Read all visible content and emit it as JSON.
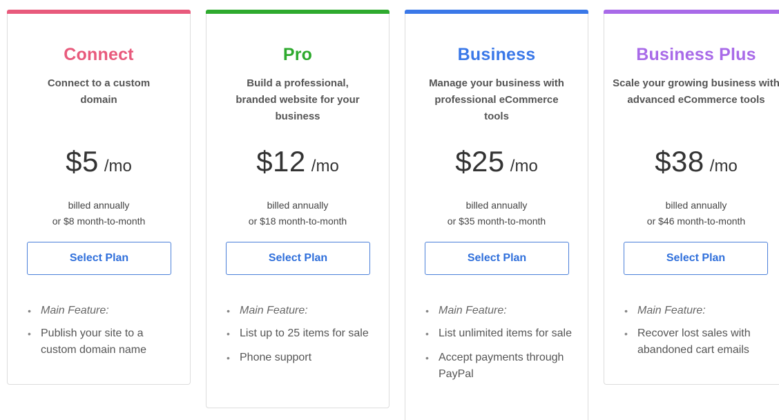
{
  "common": {
    "bullet_glyph": "•"
  },
  "plans": [
    {
      "name": "Connect",
      "color": "#e85a7c",
      "description": "Connect to a custom domain",
      "price": "$5",
      "unit": "/mo",
      "billing_line1": "billed annually",
      "billing_line2": "or $8 month-to-month",
      "button_label": "Select Plan",
      "main_feature_label": "Main Feature:",
      "features": [
        "Publish your site to a custom domain name"
      ]
    },
    {
      "name": "Pro",
      "color": "#2eaa2e",
      "description": "Build a professional, branded website for your business",
      "price": "$12",
      "unit": "/mo",
      "billing_line1": "billed annually",
      "billing_line2": "or $18 month-to-month",
      "button_label": "Select Plan",
      "main_feature_label": "Main Feature:",
      "features": [
        "List up to 25 items for sale",
        "Phone support"
      ]
    },
    {
      "name": "Business",
      "color": "#3a78e8",
      "description": "Manage your business with professional eCommerce tools",
      "price": "$25",
      "unit": "/mo",
      "billing_line1": "billed annually",
      "billing_line2": "or $35 month-to-month",
      "button_label": "Select Plan",
      "main_feature_label": "Main Feature:",
      "features": [
        "List unlimited items for sale",
        "Accept payments through PayPal"
      ]
    },
    {
      "name": "Business Plus",
      "color": "#a86ae8",
      "description": "Scale your growing business with advanced eCommerce tools",
      "price": "$38",
      "unit": "/mo",
      "billing_line1": "billed annually",
      "billing_line2": "or $46 month-to-month",
      "button_label": "Select Plan",
      "main_feature_label": "Main Feature:",
      "features": [
        "Recover lost sales with abandoned cart emails"
      ]
    }
  ]
}
